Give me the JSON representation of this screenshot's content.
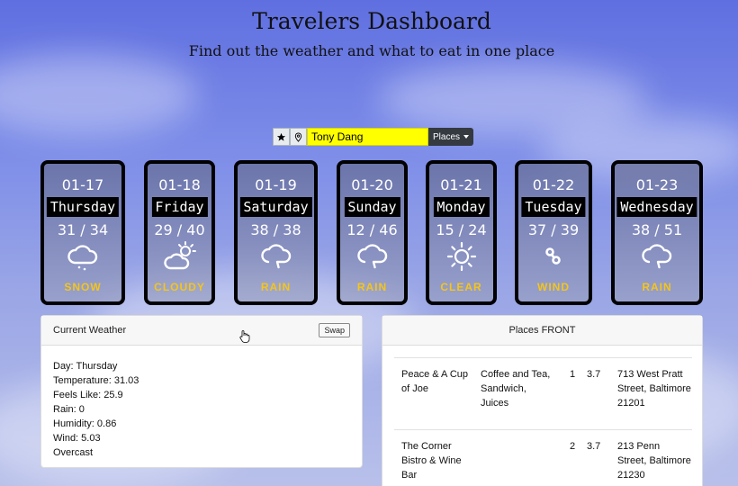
{
  "header": {
    "title": "Travelers Dashboard",
    "subtitle": "Find out the weather and what to eat in one place"
  },
  "search": {
    "value": "Tony Dang",
    "places_label": "Places"
  },
  "forecast": [
    {
      "date": "01-17",
      "day": "Thursday",
      "temps": "31 / 34",
      "condition": "SNOW",
      "icon": "snow-icon"
    },
    {
      "date": "01-18",
      "day": "Friday",
      "temps": "29 / 40",
      "condition": "CLOUDY",
      "icon": "partly-cloudy-icon"
    },
    {
      "date": "01-19",
      "day": "Saturday",
      "temps": "38 / 38",
      "condition": "RAIN",
      "icon": "rain-icon"
    },
    {
      "date": "01-20",
      "day": "Sunday",
      "temps": "12 / 46",
      "condition": "RAIN",
      "icon": "rain-icon"
    },
    {
      "date": "01-21",
      "day": "Monday",
      "temps": "15 / 24",
      "condition": "CLEAR",
      "icon": "sun-icon"
    },
    {
      "date": "01-22",
      "day": "Tuesday",
      "temps": "37 / 39",
      "condition": "WIND",
      "icon": "wind-icon"
    },
    {
      "date": "01-23",
      "day": "Wednesday",
      "temps": "38 / 51",
      "condition": "RAIN",
      "icon": "rain-icon"
    }
  ],
  "current_weather": {
    "title": "Current Weather",
    "swap_label": "Swap",
    "lines": [
      "Day: Thursday",
      "Temperature: 31.03",
      "Feels Like: 25.9",
      "Rain: 0",
      "Humidity: 0.86",
      "Wind: 5.03",
      "Overcast"
    ]
  },
  "places": {
    "title": "Places FRONT",
    "rows": [
      {
        "name": "Peace & A Cup of Joe",
        "category": "Coffee and Tea, Sandwich, Juices",
        "price": "1",
        "rating": "3.7",
        "address": "713 West Pratt Street, Baltimore 21201"
      },
      {
        "name": "The Corner Bistro & Wine Bar",
        "category": "",
        "price": "2",
        "rating": "3.7",
        "address": "213 Penn Street, Baltimore 21230"
      }
    ]
  },
  "colors": {
    "search_highlight": "#ffff00",
    "condition_text": "#f5c518",
    "dropdown_bg": "#343a40"
  }
}
